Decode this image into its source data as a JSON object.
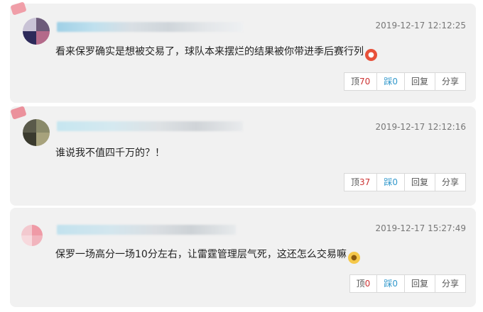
{
  "comments": [
    {
      "timestamp": "2019-12-17 12:12:25",
      "text": "看来保罗确实是想被交易了，球队本来摆烂的结果被你带进季后赛行列",
      "emoji_icon": "angry-face-icon",
      "up_label": "顶",
      "up_count": "70",
      "down_label": "踩",
      "down_count": "0",
      "reply_label": "回复",
      "share_label": "分享"
    },
    {
      "timestamp": "2019-12-17 12:12:16",
      "text": "谁说我不值四千万的？！",
      "up_label": "顶",
      "up_count": "37",
      "down_label": "踩",
      "down_count": "0",
      "reply_label": "回复",
      "share_label": "分享"
    },
    {
      "timestamp": "2019-12-17 15:27:49",
      "text": "保罗一场高分一场10分左右，让雷霆管理层气死，这还怎么交易嘛",
      "emoji_icon": "sweat-face-icon",
      "up_label": "顶",
      "up_count": "0",
      "down_label": "踩",
      "down_count": "0",
      "reply_label": "回复",
      "share_label": "分享"
    }
  ],
  "colors": {
    "up_count": "#cc3333",
    "down": "#3399cc",
    "card_bg": "#f1f1f1"
  }
}
